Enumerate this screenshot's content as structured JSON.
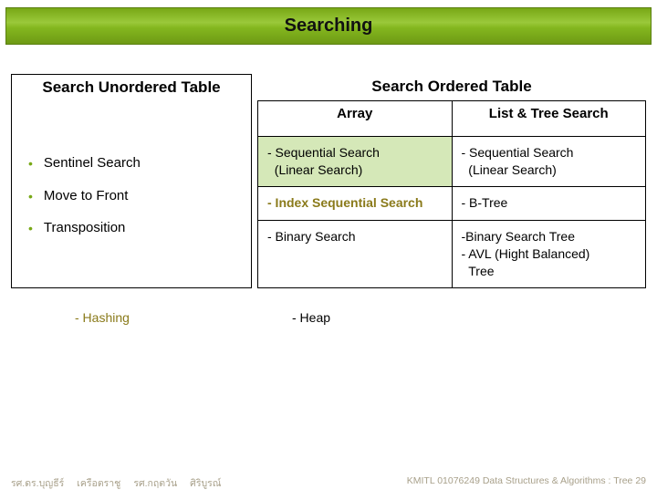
{
  "title": "Searching",
  "leftHeader": "Search Unordered Table",
  "rightHeader": "Search Ordered Table",
  "subCols": {
    "a": "Array",
    "b": "List & Tree Search"
  },
  "bullets": {
    "b1": "Sentinel Search",
    "b2": "Move to Front",
    "b3": "Transposition"
  },
  "cells": {
    "r1c1a": "- Sequential Search",
    "r1c1b": "  (Linear Search)",
    "r1c2a": "- Sequential Search",
    "r1c2b": "  (Linear Search)",
    "r2c1": "- Index Sequential Search",
    "r2c2": "- B-Tree",
    "r3c1": "- Binary Search",
    "r3c2a": "-Binary Search Tree",
    "r3c2b": "- AVL (Hight Balanced)",
    "r3c2c": "  Tree"
  },
  "bottom": {
    "left": "- Hashing",
    "right": "- Heap"
  },
  "footer": {
    "name1a": "รศ.ดร.บุญธีร์",
    "name1b": "เครือตราชู",
    "name2a": "รศ.กฤตวัน",
    "name2b": "ศิริบูรณ์",
    "right": "KMITL   01076249 Data Structures & Algorithms : Tree 29"
  }
}
